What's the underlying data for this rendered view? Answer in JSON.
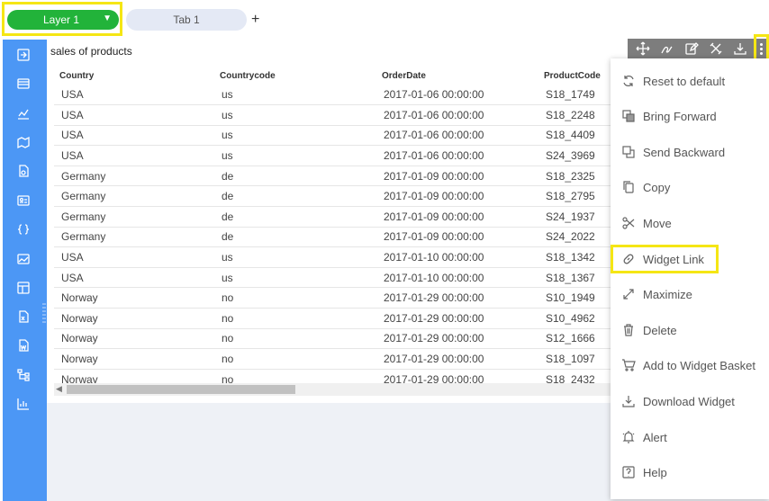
{
  "tabs": {
    "layer_label": "Layer 1",
    "tab_label": "Tab 1",
    "add_label": "+"
  },
  "widget": {
    "title": "sales of products",
    "columns": [
      "Country",
      "Countrycode",
      "OrderDate",
      "ProductCode"
    ],
    "rows": [
      [
        "USA",
        "us",
        "2017-01-06 00:00:00",
        "S18_1749"
      ],
      [
        "USA",
        "us",
        "2017-01-06 00:00:00",
        "S18_2248"
      ],
      [
        "USA",
        "us",
        "2017-01-06 00:00:00",
        "S18_4409"
      ],
      [
        "USA",
        "us",
        "2017-01-06 00:00:00",
        "S24_3969"
      ],
      [
        "Germany",
        "de",
        "2017-01-09 00:00:00",
        "S18_2325"
      ],
      [
        "Germany",
        "de",
        "2017-01-09 00:00:00",
        "S18_2795"
      ],
      [
        "Germany",
        "de",
        "2017-01-09 00:00:00",
        "S24_1937"
      ],
      [
        "Germany",
        "de",
        "2017-01-09 00:00:00",
        "S24_2022"
      ],
      [
        "USA",
        "us",
        "2017-01-10 00:00:00",
        "S18_1342"
      ],
      [
        "USA",
        "us",
        "2017-01-10 00:00:00",
        "S18_1367"
      ],
      [
        "Norway",
        "no",
        "2017-01-29 00:00:00",
        "S10_1949"
      ],
      [
        "Norway",
        "no",
        "2017-01-29 00:00:00",
        "S10_4962"
      ],
      [
        "Norway",
        "no",
        "2017-01-29 00:00:00",
        "S12_1666"
      ],
      [
        "Norway",
        "no",
        "2017-01-29 00:00:00",
        "S18_1097"
      ],
      [
        "Norway",
        "no",
        "2017-01-29 00:00:00",
        "S18_2432"
      ]
    ]
  },
  "menu": {
    "items": [
      {
        "label": "Reset to default",
        "icon": "refresh-icon"
      },
      {
        "label": "Bring Forward",
        "icon": "bring-forward-icon"
      },
      {
        "label": "Send Backward",
        "icon": "send-backward-icon"
      },
      {
        "label": "Copy",
        "icon": "copy-icon"
      },
      {
        "label": "Move",
        "icon": "scissors-icon"
      },
      {
        "label": "Widget Link",
        "icon": "link-icon"
      },
      {
        "label": "Maximize",
        "icon": "maximize-icon"
      },
      {
        "label": "Delete",
        "icon": "trash-icon"
      },
      {
        "label": "Add to Widget Basket",
        "icon": "basket-icon"
      },
      {
        "label": "Download Widget",
        "icon": "download-icon"
      },
      {
        "label": "Alert",
        "icon": "bell-icon"
      },
      {
        "label": "Help",
        "icon": "help-icon"
      }
    ]
  },
  "colors": {
    "layer": "#22b33a",
    "sidebar": "#4c97f5",
    "highlight": "#f5e614",
    "toolbar": "#7d7d7d"
  }
}
